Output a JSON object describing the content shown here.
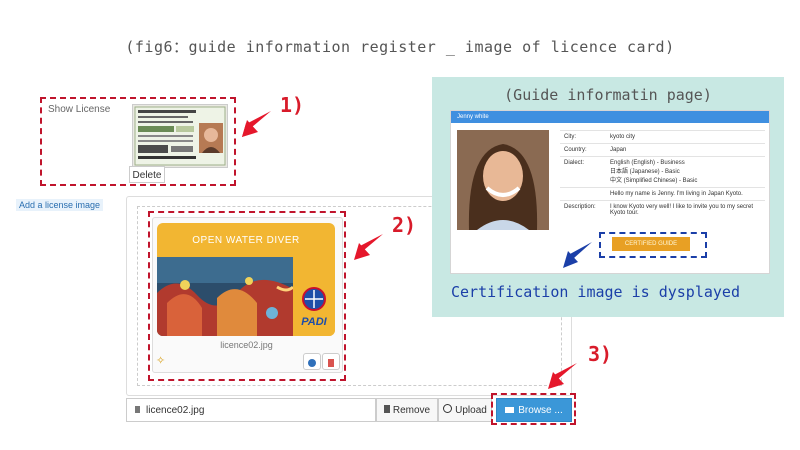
{
  "caption": "(fig6：guide information register _ image of licence card)",
  "show_license_label": "Show License",
  "delete_button": "Delete",
  "add_license_link": "Add a license image",
  "steps": {
    "one": "1)",
    "two": "2)",
    "three": "3)"
  },
  "preview": {
    "card_title": "OPEN WATER DIVER",
    "card_logo": "PADI",
    "filename": "licence02.jpg"
  },
  "file_bar": {
    "filename": "licence02.jpg",
    "remove_label": "Remove",
    "upload_label": "Upload",
    "browse_label": "Browse ..."
  },
  "guide_page": {
    "title": "(Guide informatin page)",
    "header_name": "Jenny white",
    "rows": [
      {
        "label": "City:",
        "value": "kyoto city"
      },
      {
        "label": "Country:",
        "value": "Japan"
      },
      {
        "label": "Dialect:",
        "value": "English (English) - Business\n日本語 (Japanese) - Basic\n中文 (Simplified Chinese) - Basic"
      },
      {
        "label": "",
        "value": "Hello my name is Jenny. I'm living in Japan Kyoto."
      },
      {
        "label": "Description:",
        "value": "I know Kyoto very well! I like to invite you to my secret Kyoto tour."
      }
    ],
    "cert_badge": "CERTIFIED GUIDE",
    "footer_note": "Certification image is dysplayed"
  },
  "colors": {
    "red": "#c0142c",
    "blue": "#1b3fa8",
    "teal": "#c8e8e3",
    "primary": "#3b97d8"
  }
}
